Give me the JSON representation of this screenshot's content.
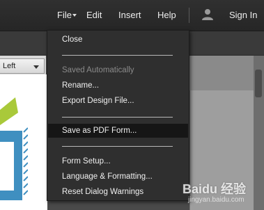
{
  "topbar": {
    "file_label": "File",
    "edit_label": "Edit",
    "insert_label": "Insert",
    "help_label": "Help",
    "signin_label": "Sign In",
    "user_icon": "user-icon"
  },
  "toolbar": {
    "align_value": "Left"
  },
  "file_menu": {
    "items": [
      {
        "label": "Close",
        "enabled": true,
        "highlighted": false
      },
      {
        "label": "Saved Automatically",
        "enabled": false,
        "highlighted": false
      },
      {
        "label": "Rename...",
        "enabled": true,
        "highlighted": false
      },
      {
        "label": "Export Design File...",
        "enabled": true,
        "highlighted": false
      },
      {
        "label": "Save as PDF Form...",
        "enabled": true,
        "highlighted": true
      },
      {
        "label": "Form Setup...",
        "enabled": true,
        "highlighted": false
      },
      {
        "label": "Language & Formatting...",
        "enabled": true,
        "highlighted": false
      },
      {
        "label": "Reset Dialog Warnings",
        "enabled": true,
        "highlighted": false
      }
    ]
  },
  "watermark": {
    "brand": "Baidu 经验",
    "url": "jingyan.baidu.com"
  },
  "colors": {
    "menu_bg": "#2f2f2f",
    "highlight_bg": "#161616",
    "artwork_blue": "#3f8fc0",
    "artwork_green": "#a9c93a"
  }
}
